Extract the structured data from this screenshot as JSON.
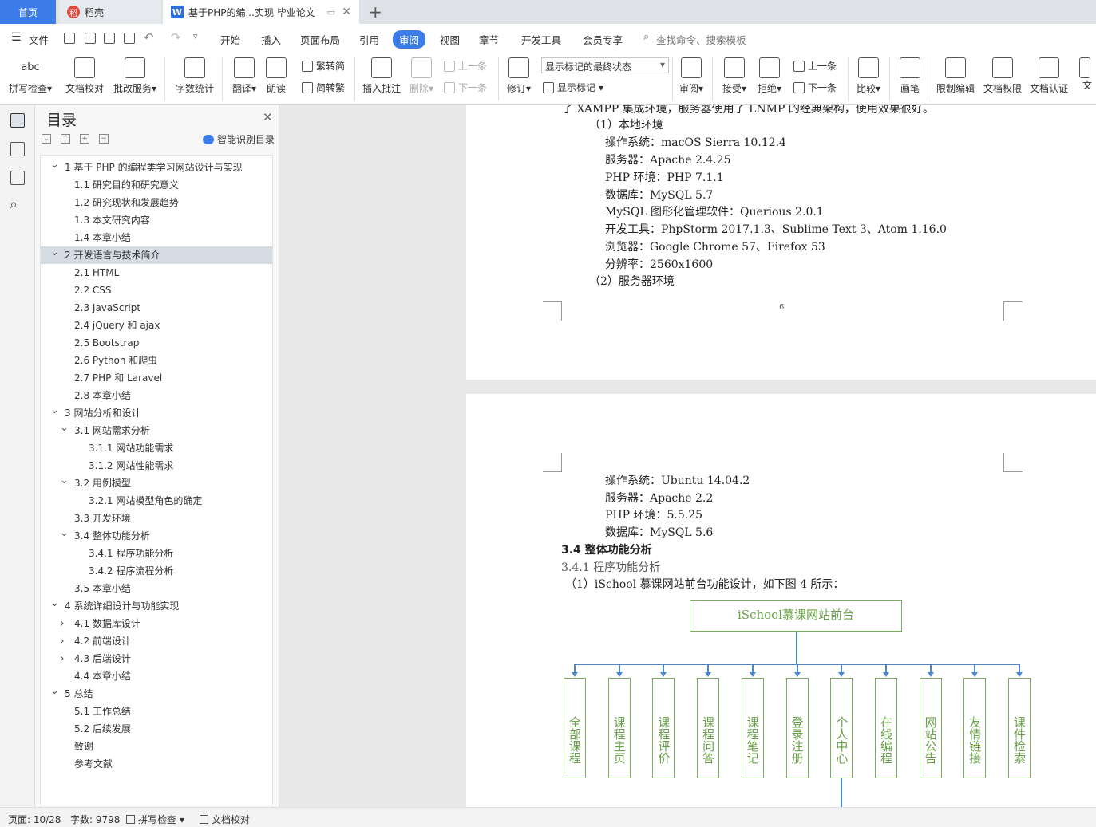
{
  "tabs": {
    "home": "首页",
    "daoke": "稻壳",
    "doc": "基于PHP的编...实现 毕业论文"
  },
  "menu": {
    "file": "文件",
    "items": [
      "开始",
      "插入",
      "页面布局",
      "引用",
      "审阅",
      "视图",
      "章节",
      "开发工具",
      "会员专享"
    ],
    "active": "审阅",
    "search": "查找命令、搜索模板"
  },
  "ribbon": {
    "spell": "拼写检查",
    "proof": "文档校对",
    "annotate_service": "批改服务",
    "word_count": "字数统计",
    "translate": "翻译",
    "read_aloud": "朗读",
    "trad": "繁转简",
    "simp": "简转繁",
    "insert_comment": "插入批注",
    "delete": "删除",
    "prev_comment": "上一条",
    "next_comment": "下一条",
    "track": "修订",
    "markup_state": "显示标记的最终状态",
    "show_markup": "显示标记",
    "review": "审阅",
    "accept": "接受",
    "reject": "拒绝",
    "prev_change": "上一条",
    "next_change": "下一条",
    "compare": "比较",
    "pen": "画笔",
    "restrict": "限制编辑",
    "permission": "文档权限",
    "certify": "文档认证",
    "more": "文"
  },
  "toc": {
    "title": "目录",
    "smart": "智能识别目录",
    "items": [
      {
        "label": "1  基于 PHP 的编程类学习网站设计与实现",
        "level": 1,
        "arrow": "v"
      },
      {
        "label": "1.1  研究目的和研究意义",
        "level": 2
      },
      {
        "label": "1.2  研究现状和发展趋势",
        "level": 2
      },
      {
        "label": "1.3  本文研究内容",
        "level": 2
      },
      {
        "label": "1.4  本章小结",
        "level": 2
      },
      {
        "label": "2  开发语言与技术简介",
        "level": 1,
        "arrow": "v",
        "selected": true
      },
      {
        "label": "2.1 HTML",
        "level": 2
      },
      {
        "label": "2.2 CSS",
        "level": 2
      },
      {
        "label": "2.3 JavaScript",
        "level": 2
      },
      {
        "label": "2.4 jQuery 和 ajax",
        "level": 2
      },
      {
        "label": "2.5 Bootstrap",
        "level": 2
      },
      {
        "label": "2.6 Python 和爬虫",
        "level": 2
      },
      {
        "label": "2.7 PHP 和 Laravel",
        "level": 2
      },
      {
        "label": "2.8  本章小结",
        "level": 2
      },
      {
        "label": "3  网站分析和设计",
        "level": 1,
        "arrow": "v"
      },
      {
        "label": "3.1  网站需求分析",
        "level": 2,
        "arrow": "v"
      },
      {
        "label": "3.1.1  网站功能需求",
        "level": 3
      },
      {
        "label": "3.1.2  网站性能需求",
        "level": 3
      },
      {
        "label": "3.2  用例模型",
        "level": 2,
        "arrow": "v"
      },
      {
        "label": "3.2.1 网站模型角色的确定",
        "level": 3
      },
      {
        "label": "3.3  开发环境",
        "level": 2
      },
      {
        "label": "3.4  整体功能分析",
        "level": 2,
        "arrow": "v"
      },
      {
        "label": "3.4.1  程序功能分析",
        "level": 3
      },
      {
        "label": "3.4.2  程序流程分析",
        "level": 3
      },
      {
        "label": "3.5  本章小结",
        "level": 2
      },
      {
        "label": "4  系统详细设计与功能实现",
        "level": 1,
        "arrow": "v"
      },
      {
        "label": "4.1  数据库设计",
        "level": 2,
        "arrow": ">"
      },
      {
        "label": "4.2  前端设计",
        "level": 2,
        "arrow": ">"
      },
      {
        "label": "4.3  后端设计",
        "level": 2,
        "arrow": ">"
      },
      {
        "label": "4.4  本章小结",
        "level": 2
      },
      {
        "label": "5  总结",
        "level": 1,
        "arrow": "v"
      },
      {
        "label": "5.1  工作总结",
        "level": 2
      },
      {
        "label": "5.2  后续发展",
        "level": 2
      },
      {
        "label": "致谢",
        "level": 2
      },
      {
        "label": "参考文献",
        "level": 2
      }
    ]
  },
  "doc": {
    "page1_lines": [
      "了 XAMPP 集成环境，服务器使用了 LNMP 的经典架构，使用效果很好。",
      "（1）本地环境",
      "操作系统：macOS Sierra 10.12.4",
      "服务器：Apache 2.4.25",
      "PHP 环境：PHP 7.1.1",
      "数据库：MySQL 5.7",
      "MySQL 图形化管理软件：Querious 2.0.1",
      "开发工具：PhpStorm 2017.1.3、Sublime Text 3、Atom 1.16.0",
      "浏览器：Google Chrome 57、Firefox 53",
      "分辨率：2560x1600",
      "（2）服务器环境"
    ],
    "page_number": "6",
    "page2_lines": [
      "操作系统：Ubuntu 14.04.2",
      "服务器：Apache 2.2",
      "PHP 环境：5.5.25",
      "数据库：MySQL 5.6"
    ],
    "heading": "3.4  整体功能分析",
    "subheading": "3.4.1  程序功能分析",
    "para": "（1）iSchool 慕课网站前台功能设计，如下图 4 所示：",
    "chart_root": "iSchool慕课网站前台",
    "chart_children": [
      "全部课程",
      "课程主页",
      "课程评价",
      "课程问答",
      "课程笔记",
      "登录注册",
      "个人中心",
      "在线编程",
      "网站公告",
      "友情链接",
      "课件检索"
    ]
  },
  "status": {
    "page": "页面: 10/28",
    "words": "字数: 9798",
    "spell": "拼写检查",
    "proof": "文档校对"
  }
}
